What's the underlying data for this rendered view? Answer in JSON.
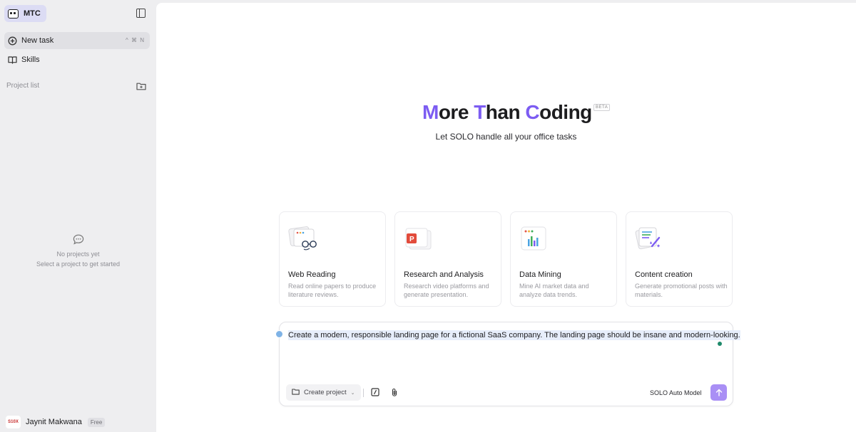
{
  "sidebar": {
    "brand": "MTC",
    "nav": [
      {
        "label": "New task",
        "shortcut": "^ ⌘ N"
      },
      {
        "label": "Skills"
      }
    ],
    "section_label": "Project list",
    "empty_state": {
      "line1": "No projects yet",
      "line2": "Select a project to get started"
    },
    "user": {
      "avatar_text": "S10X",
      "name": "Jaynit Makwana",
      "plan": "Free"
    }
  },
  "hero": {
    "title_parts": [
      "M",
      "ore ",
      "T",
      "han ",
      "C",
      "oding"
    ],
    "badge": "BETA",
    "subtitle": "Let SOLO handle all your office tasks"
  },
  "cards": [
    {
      "title": "Web Reading",
      "desc": "Read online papers to produce literature reviews.",
      "icon": "web-reading-icon"
    },
    {
      "title": "Research and Analysis",
      "desc": "Research video platforms and generate presentation.",
      "icon": "presentation-icon"
    },
    {
      "title": "Data Mining",
      "desc": "Mine AI market data and analyze data trends.",
      "icon": "chart-icon"
    },
    {
      "title": "Content creation",
      "desc": "Generate promotional posts with materials.",
      "icon": "pen-icon"
    }
  ],
  "composer": {
    "prompt": "Create a modern, responsible landing page for a fictional SaaS company. The landing page should be insane and modern-looking.",
    "create_project_label": "Create project",
    "model_label": "SOLO Auto Model"
  },
  "colors": {
    "accent": "#7c5cf2",
    "send_button": "#a98ff5",
    "status_dot": "#1f8a6b"
  }
}
